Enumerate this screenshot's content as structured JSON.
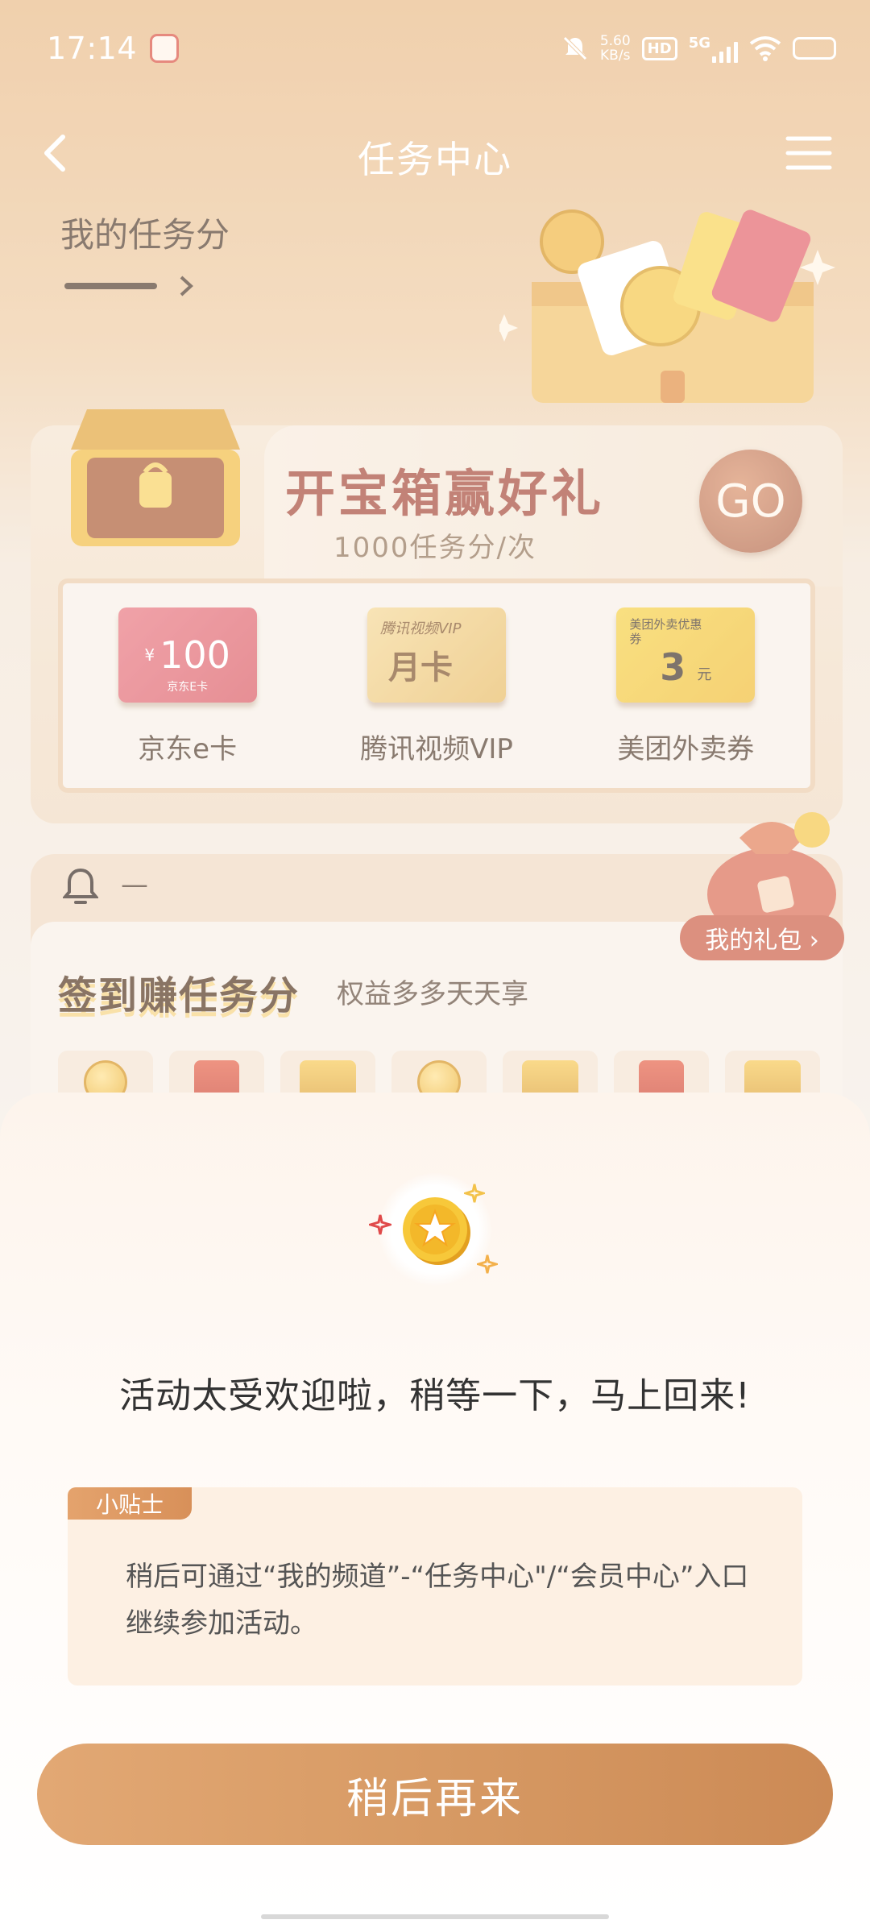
{
  "status_bar": {
    "time": "17:14",
    "net_speed_value": "5.60",
    "net_speed_unit": "KB/s",
    "hd_label": "HD",
    "network_label": "5G"
  },
  "nav": {
    "title": "任务中心"
  },
  "score": {
    "label": "我的任务分"
  },
  "treasure": {
    "title": "开宝箱赢好礼",
    "subtitle": "1000任务分/次",
    "go_label": "GO",
    "prizes": [
      {
        "label": "京东e卡",
        "card_amount": "100",
        "card_currency": "¥",
        "card_caption": "京东E卡"
      },
      {
        "label": "腾讯视频VIP",
        "card_top": "腾讯视频VIP",
        "card_main": "月卡"
      },
      {
        "label": "美团外卖券",
        "card_top": "美团外卖优惠券",
        "card_amount": "3",
        "card_unit": "元"
      }
    ]
  },
  "signin": {
    "notice": "—",
    "title": "签到赚任务分",
    "subtitle": "权益多多天天享",
    "my_gift_label": "我的礼包 ›"
  },
  "sheet": {
    "title": "活动太受欢迎啦，稍等一下，马上回来!",
    "tip_tag": "小贴士",
    "tip_text": "稍后可通过“我的频道”-“任务中心\"/“会员中心”入口继续参加活动。",
    "button_label": "稍后再来"
  },
  "colors": {
    "accent": "#d79a64",
    "title_red": "#a2402e",
    "text_dark": "#333333"
  }
}
